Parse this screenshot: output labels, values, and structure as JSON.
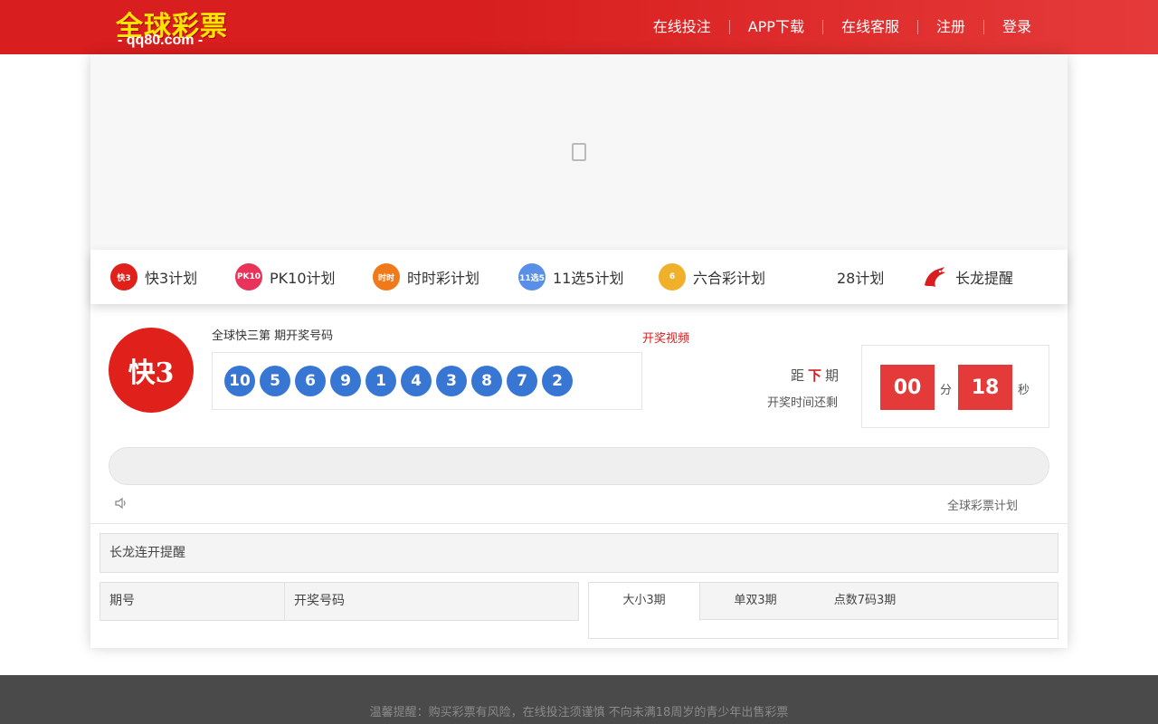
{
  "header": {
    "logo_text": "全球彩票",
    "logo_sub": "- qq80.com -",
    "nav": [
      {
        "label": "在线投注"
      },
      {
        "label": "APP下载"
      },
      {
        "label": "在线客服"
      },
      {
        "label": "注册"
      },
      {
        "label": "登录"
      }
    ]
  },
  "plans": [
    {
      "label": "快3计划",
      "icon": "k3-icon",
      "color": "#e0201a",
      "icon_text": "快3"
    },
    {
      "label": "PK10计划",
      "icon": "pk10-icon",
      "color": "#e8335a",
      "icon_text": "PK10"
    },
    {
      "label": "时时彩计划",
      "icon": "ssc-icon",
      "color": "#f07a1a",
      "icon_text": "时时"
    },
    {
      "label": "11选5计划",
      "icon": "11x5-icon",
      "color": "#5a8fe8",
      "icon_text": "11选5"
    },
    {
      "label": "六合彩计划",
      "icon": "lhc-icon",
      "color": "#f0b02a",
      "icon_text": "6"
    },
    {
      "label": "28计划",
      "icon": "",
      "color": "",
      "icon_text": ""
    },
    {
      "label": "长龙提醒",
      "icon": "dragon-icon",
      "color": "#d81e1e",
      "icon_text": ""
    }
  ],
  "draw": {
    "logo_text": "快3",
    "issue_title": "全球快三第  期开奖号码",
    "video_link": "开奖视频",
    "balls": [
      "10",
      "5",
      "6",
      "9",
      "1",
      "4",
      "3",
      "8",
      "7",
      "2"
    ],
    "ball_color": "#3876d4",
    "dist_prefix": "距",
    "dist_next": "下",
    "dist_suffix": "期",
    "remain_label": "开奖时间还剩",
    "minutes": "00",
    "minutes_unit": "分",
    "seconds": "18",
    "seconds_unit": "秒",
    "plan_link": "全球彩票计划"
  },
  "longdragon": {
    "title": "长龙连开提醒",
    "columns": [
      "期号",
      "开奖号码"
    ],
    "tabs": [
      "大小3期",
      "单双3期",
      "点数7码3期"
    ]
  },
  "footer": {
    "text": "温馨提醒：购买彩票有风险，在线投注须谨慎 不向未满18周岁的青少年出售彩票"
  }
}
